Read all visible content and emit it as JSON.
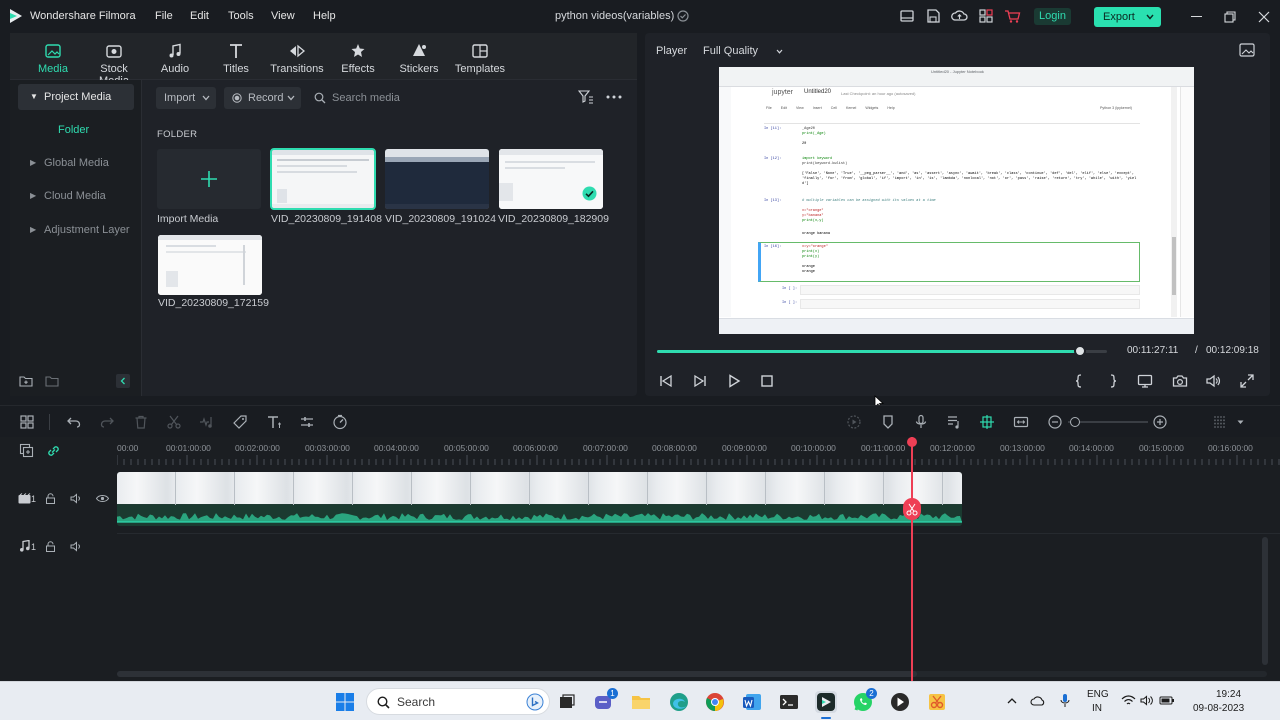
{
  "app": {
    "name": "Wondershare Filmora",
    "project_title": "python videos(variables)",
    "menu": [
      "File",
      "Edit",
      "Tools",
      "View",
      "Help"
    ],
    "login_label": "Login",
    "export_label": "Export"
  },
  "media_tabs": [
    {
      "label": "Media",
      "icon": "media-icon",
      "active": true
    },
    {
      "label": "Stock Media",
      "icon": "stock-media-icon",
      "active": false
    },
    {
      "label": "Audio",
      "icon": "audio-icon",
      "active": false
    },
    {
      "label": "Titles",
      "icon": "titles-icon",
      "active": false
    },
    {
      "label": "Transitions",
      "icon": "transitions-icon",
      "active": false
    },
    {
      "label": "Effects",
      "icon": "effects-icon",
      "active": false
    },
    {
      "label": "Stickers",
      "icon": "stickers-icon",
      "active": false
    },
    {
      "label": "Templates",
      "icon": "templates-icon",
      "active": false
    }
  ],
  "sidebar": {
    "project_media": "Project Media",
    "folder": "Folder",
    "global_media": "Global Media",
    "cloud_media": "Cloud Media",
    "adjustment_layer": "Adjustment Layer"
  },
  "media_toolbar": {
    "import_label": "Import",
    "record_label": "Record",
    "search_placeholder": "Search media"
  },
  "library": {
    "section_label": "FOLDER",
    "import_media_label": "Import Media",
    "items": [
      {
        "name": "VID_20230809_191408",
        "selected": true
      },
      {
        "name": "VID_20230809_191024",
        "selected": false
      },
      {
        "name": "VID_20230809_182909",
        "selected": false,
        "added": true
      },
      {
        "name": "VID_20230809_172159",
        "selected": false
      }
    ]
  },
  "player": {
    "label": "Player",
    "quality": "Full Quality",
    "current_time": "00:11:27:11",
    "separator": "/",
    "total_time": "00:12:09:18",
    "progress": 0.94
  },
  "preview": {
    "tab_title": "Untitled20 - Jupyter Notebook",
    "notebook_title": "Untitled20",
    "checkpoint": "Last Checkpoint: an hour ago (autosaved)",
    "logo": "jupyter",
    "kernel": "Python 3 (ipykernel)",
    "menu": [
      "File",
      "Edit",
      "View",
      "Insert",
      "Cell",
      "Kernel",
      "Widgets",
      "Help"
    ],
    "cells": [
      {
        "prompt": "In [11]:",
        "code": [
          "_Age20",
          "print(_Age)"
        ],
        "output": [
          "20"
        ]
      },
      {
        "prompt": "In [12]:",
        "code": [
          "import keyword",
          "print(keyword.kwlist)"
        ],
        "output": [
          "['False', 'None', 'True', '__peg_parser__', 'and', 'as', 'assert', 'async', 'await', 'break', 'class', 'continue', 'def', 'del', 'elif', 'else', 'except', 'finally', 'for', 'from', 'global', 'if', 'import', 'in', 'is', 'lambda', 'nonlocal', 'not', 'or', 'pass', 'raise', 'return', 'try', 'while', 'with', 'yield']"
        ]
      },
      {
        "prompt": "In [13]:",
        "code": [
          "# multiple variables can be assigned with its values at a time",
          "x=\"orange\"",
          "y=\"banana\"",
          "print(x,y)"
        ],
        "output": [
          "orange banana"
        ]
      },
      {
        "prompt": "In [16]:",
        "code": [
          "x=y=\"orange\"",
          "print(x)",
          "print(y)"
        ],
        "output": [
          "orange",
          "orange"
        ]
      },
      {
        "prompt": "In [ ]:",
        "code": [],
        "output": []
      },
      {
        "prompt": "In [ ]:",
        "code": [],
        "output": []
      }
    ]
  },
  "timeline": {
    "ruler": [
      "00:00",
      "00:01:00:00",
      "00:02:00:00",
      "00:03:00:00",
      "00:04:00:00",
      "00:05:00:00",
      "00:06:00:00",
      "00:07:00:00",
      "00:08:00:00",
      "00:09:00:00",
      "00:10:00:00",
      "00:11:00:00",
      "00:12:00:00",
      "00:13:00:00",
      "00:14:00:00",
      "00:15:00:00",
      "00:16:00:00"
    ],
    "video_track_num": "1",
    "audio_track_num": "1"
  },
  "taskbar": {
    "search_label": "Search",
    "lang_line1": "ENG",
    "lang_line2": "IN",
    "time": "19:24",
    "date": "09-08-2023",
    "teams_badge": "1",
    "whatsapp_badge": "2"
  },
  "colors": {
    "accent": "#2fdcb0",
    "playhead": "#ee3f55",
    "background": "#191c21",
    "panel": "#1f2228"
  }
}
